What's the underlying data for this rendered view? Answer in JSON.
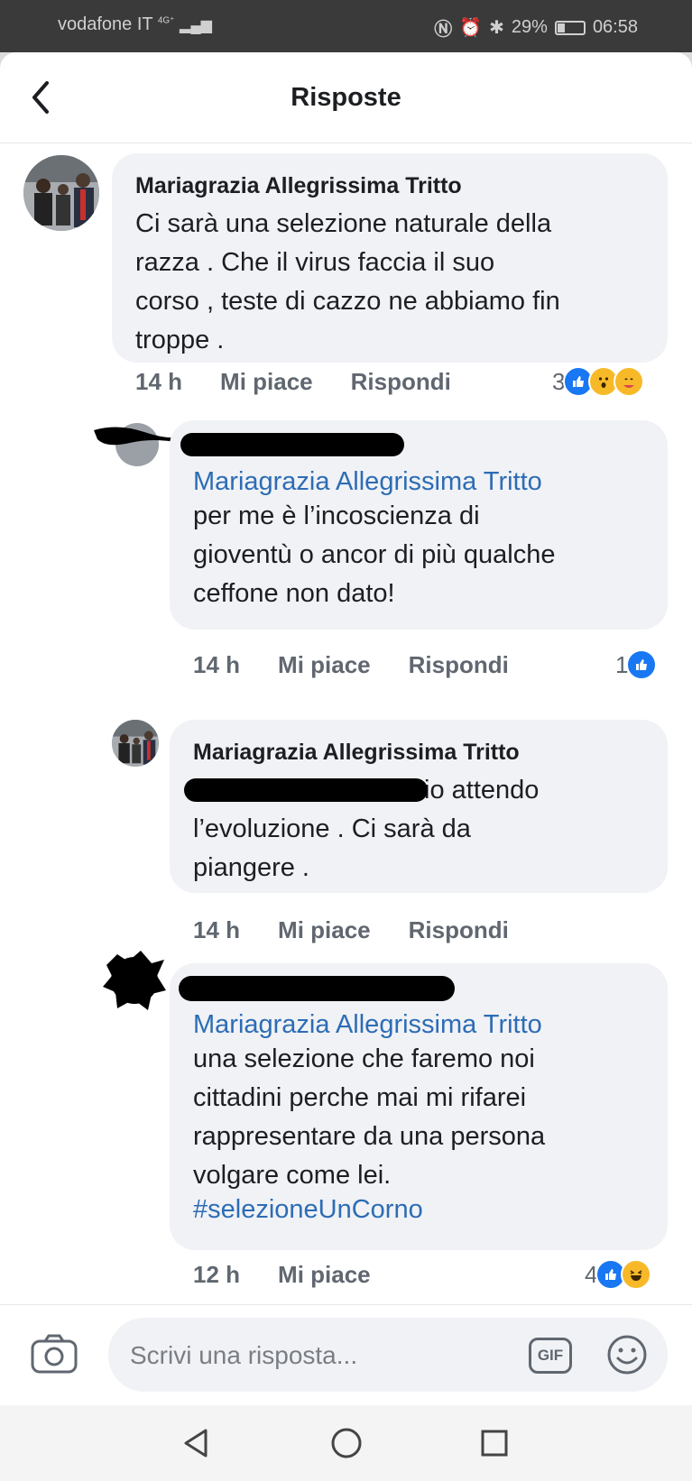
{
  "status_bar": {
    "carrier": "vodafone IT",
    "network": "4G⁺",
    "battery": "29%",
    "time": "06:58"
  },
  "header": {
    "title": "Risposte"
  },
  "comments": [
    {
      "author": "Mariagrazia Allegrissima Tritto",
      "lines": [
        "Ci sarà una selezione naturale della",
        "razza . Che il virus faccia il suo",
        "corso , teste di cazzo ne abbiamo fin",
        "troppe ."
      ],
      "time": "14 h",
      "like": "Mi piace",
      "reply": "Rispondi",
      "reaction_count": "3"
    },
    {
      "tag": "Mariagrazia Allegrissima Tritto",
      "lines": [
        "per me è l’incoscienza di",
        "gioventù o ancor di più qualche",
        "ceffone non dato!"
      ],
      "time": "14 h",
      "like": "Mi piace",
      "reply": "Rispondi",
      "reaction_count": "1"
    },
    {
      "author": "Mariagrazia Allegrissima Tritto",
      "first_line_visible": "io attendo",
      "lines": [
        "l’evoluzione . Ci sarà da",
        "piangere ."
      ],
      "time": "14 h",
      "like": "Mi piace",
      "reply": "Rispondi"
    },
    {
      "tag": "Mariagrazia Allegrissima Tritto",
      "lines": [
        "una selezione che faremo noi",
        "cittadini perche mai mi rifarei",
        "rappresentare da una persona",
        "volgare come lei."
      ],
      "hashtag": "#selezioneUnCorno",
      "time": "12 h",
      "like": "Mi piace",
      "reaction_count": "4"
    }
  ],
  "composer": {
    "placeholder": "Scrivi una risposta...",
    "gif": "GIF"
  },
  "icons": [
    "back-arrow-icon",
    "camera-icon",
    "gif-icon",
    "emoji-icon",
    "like-reaction-icon",
    "wow-reaction-icon",
    "care-reaction-icon",
    "haha-reaction-icon",
    "nav-back-icon",
    "nav-home-icon",
    "nav-recents-icon"
  ],
  "colors": {
    "link": "#2d6cb5",
    "bubble": "#f0f2f5",
    "like_blue": "#1877f2",
    "emoji_yellow": "#f7b928"
  }
}
